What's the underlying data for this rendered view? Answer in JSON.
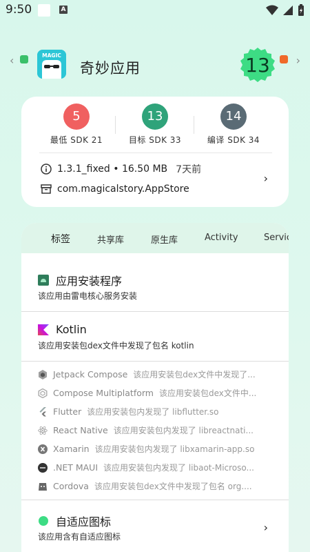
{
  "status": {
    "time": "9:50",
    "a_label": "A"
  },
  "header": {
    "app_name": "奇妙应用",
    "app_icon_text": "MAGIC",
    "target_badge": "13"
  },
  "sdk": [
    {
      "value": "5",
      "label": "最低 SDK 21",
      "color": "#f06060"
    },
    {
      "value": "13",
      "label": "目标 SDK 33",
      "color": "#2fa37a"
    },
    {
      "value": "14",
      "label": "编译 SDK 34",
      "color": "#5a6b75"
    }
  ],
  "info": {
    "version": "1.3.1_fixed • 16.50 MB",
    "time": "7天前",
    "package": "com.magicalstory.AppStore"
  },
  "tabs": [
    "标签",
    "共享库",
    "原生库",
    "Activity",
    "Servic"
  ],
  "installer": {
    "title": "应用安装程序",
    "desc": "该应用由雷电核心服务安装"
  },
  "kotlin": {
    "title": "Kotlin",
    "desc": "该应用安装包dex文件中发现了包名 kotlin"
  },
  "libs": [
    {
      "name": "Jetpack Compose",
      "desc": "该应用安装包dex文件中发现了..."
    },
    {
      "name": "Compose Multiplatform",
      "desc": "该应用安装包dex文件中..."
    },
    {
      "name": "Flutter",
      "desc": "该应用安装包内发现了 libflutter.so"
    },
    {
      "name": "React Native",
      "desc": "该应用安装包内发现了 libreactnati..."
    },
    {
      "name": "Xamarin",
      "desc": "该应用安装包内发现了 libxamarin-app.so"
    },
    {
      "name": ".NET MAUI",
      "desc": "该应用安装包内发现了 libaot-Microso..."
    },
    {
      "name": "Cordova",
      "desc": "该应用安装包dex文件中发现了包名 org...."
    }
  ],
  "adaptive": {
    "title": "自适应图标",
    "desc": "该应用含有自适应图标"
  },
  "colors": {
    "accent": "#2fa37a",
    "tab_bg": "#dff5ea",
    "badge_green": "#3ddc84"
  }
}
